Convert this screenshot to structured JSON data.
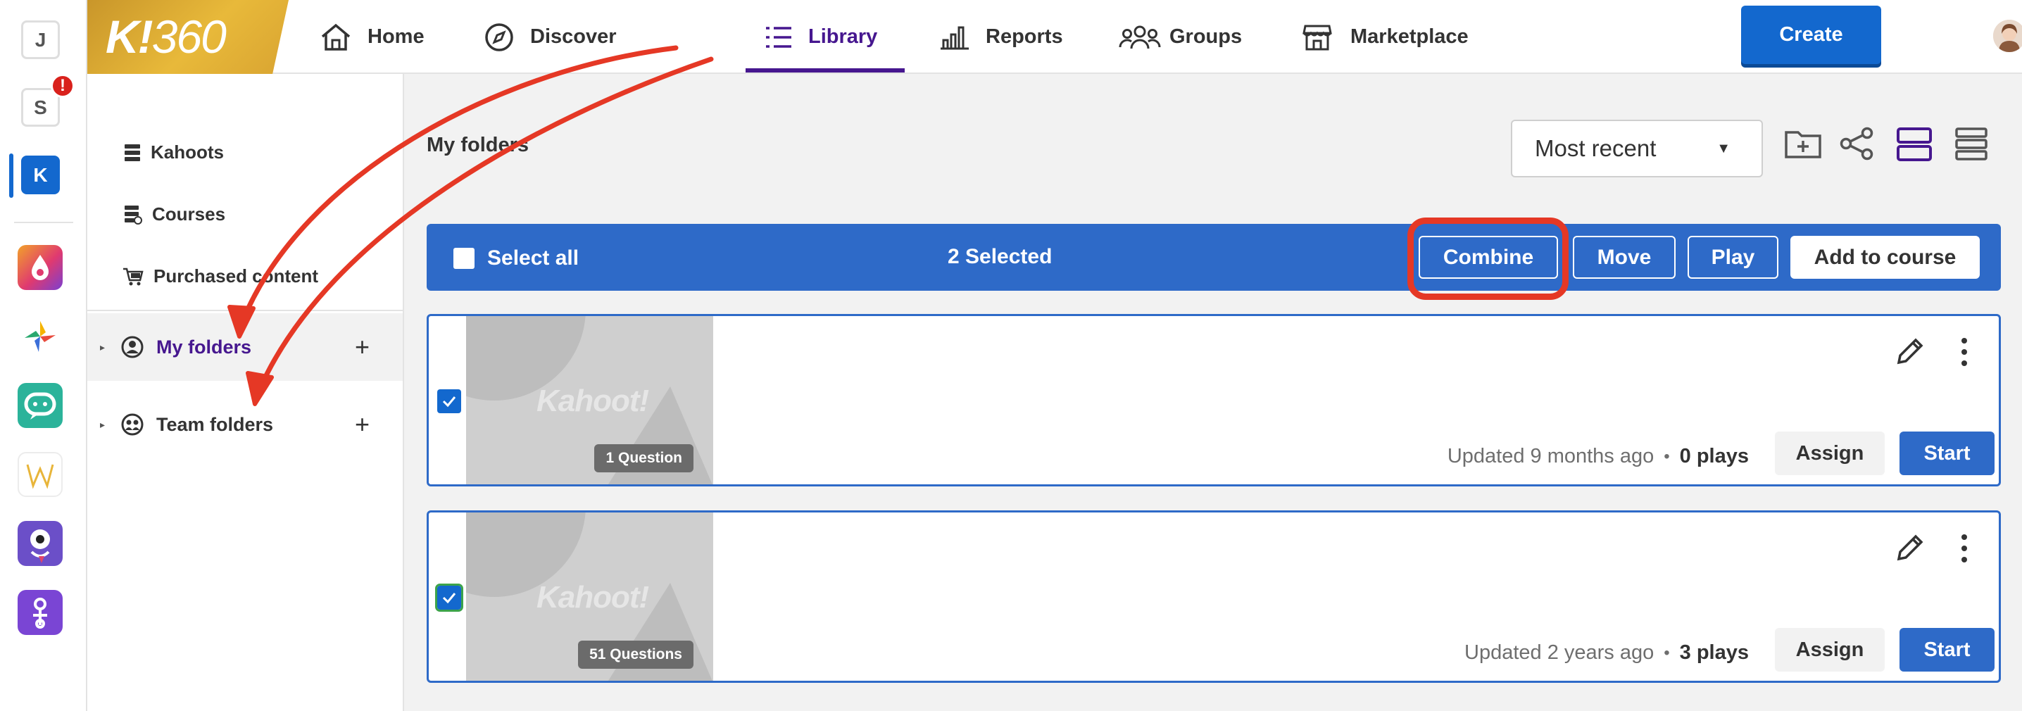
{
  "rail": {
    "workspaces": [
      "J",
      "S",
      "K"
    ],
    "badge": "!",
    "apps": [
      "drops-app-icon",
      "pinwheel-app-icon",
      "chat-app-icon",
      "wordle-app-icon",
      "monster-app-icon",
      "puzzle-app-icon"
    ]
  },
  "header": {
    "logo_main": "K!",
    "logo_sub": "360",
    "nav": [
      {
        "label": "Home",
        "icon": "home-icon"
      },
      {
        "label": "Discover",
        "icon": "compass-icon"
      },
      {
        "label": "Library",
        "icon": "list-icon",
        "active": true
      },
      {
        "label": "Reports",
        "icon": "bar-chart-icon"
      },
      {
        "label": "Groups",
        "icon": "groups-icon"
      },
      {
        "label": "Marketplace",
        "icon": "store-icon"
      }
    ],
    "create_label": "Create"
  },
  "sidebar": {
    "items": [
      "Kahoots",
      "Courses",
      "Purchased content"
    ],
    "folders": [
      {
        "label": "My folders",
        "active": true
      },
      {
        "label": "Team folders",
        "active": false
      }
    ]
  },
  "main": {
    "title": "My folders",
    "sort_value": "Most recent",
    "selection_bar": {
      "select_all": "Select all",
      "selected_count": "2 Selected",
      "actions": [
        "Combine",
        "Move",
        "Play",
        "Add to course"
      ]
    },
    "cards": [
      {
        "thumb_logo": "Kahoot!",
        "questions": "1 Question",
        "updated": "Updated 9 months ago",
        "plays": "0 plays",
        "assign": "Assign",
        "start": "Start",
        "checked": true
      },
      {
        "thumb_logo": "Kahoot!",
        "questions": "51 Questions",
        "updated": "Updated 2 years ago",
        "plays": "3 plays",
        "assign": "Assign",
        "start": "Start",
        "checked": true
      }
    ]
  },
  "colors": {
    "accent": "#1368ce",
    "bar": "#2e6ac8",
    "purple": "#46178f",
    "annotation": "#e53825"
  }
}
